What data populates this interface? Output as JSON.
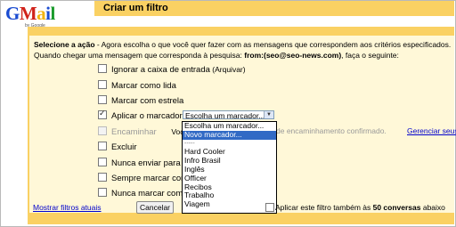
{
  "logo": {
    "letters": [
      "G",
      "M",
      "a",
      "i",
      "l",
      ""
    ],
    "by": "by Google"
  },
  "title": "Criar um filtro",
  "intro": {
    "label": "Selecione a ação",
    "text": " - Agora escolha o que você quer fazer com as mensagens que correspondem aos critérios especificados.",
    "line2_prefix": "Quando chegar uma mensagem que corresponda à pesquisa: ",
    "search": "from:(seo@seo-news.com)",
    "line2_suffix": ", faça o seguinte:"
  },
  "actions": {
    "archive": {
      "label": "Ignorar a caixa de entrada",
      "sub": " (Arquivar)"
    },
    "mark_read": "Marcar como lida",
    "star": "Marcar com estrela",
    "apply_label": "Aplicar o marcador:",
    "forward": "Encaminhar",
    "forward_tail": "Você",
    "forward_right": "de encaminhamento confirmado.",
    "manage_link": "Gerenciar seus en",
    "delete": "Excluir",
    "never_spam": "Nunca enviar para S",
    "always_important": "Sempre marcar com",
    "never_important": "Nunca marcar com"
  },
  "label_select": {
    "value": "Escolha um marcador...",
    "options": [
      "Escolha um marcador...",
      "Novo marcador...",
      "-----",
      "Hard Cooler",
      "Infro Brasil",
      "Inglês",
      "Officer",
      "Recibos",
      "Trabalho",
      "Viagem"
    ],
    "highlighted": "Novo marcador..."
  },
  "footer": {
    "show_filters": "Mostrar filtros atuais",
    "cancel": "Cancelar",
    "apply_prefix": "Aplicar este filtro também às ",
    "apply_count": "50 conversas",
    "apply_suffix": " abaixo"
  }
}
